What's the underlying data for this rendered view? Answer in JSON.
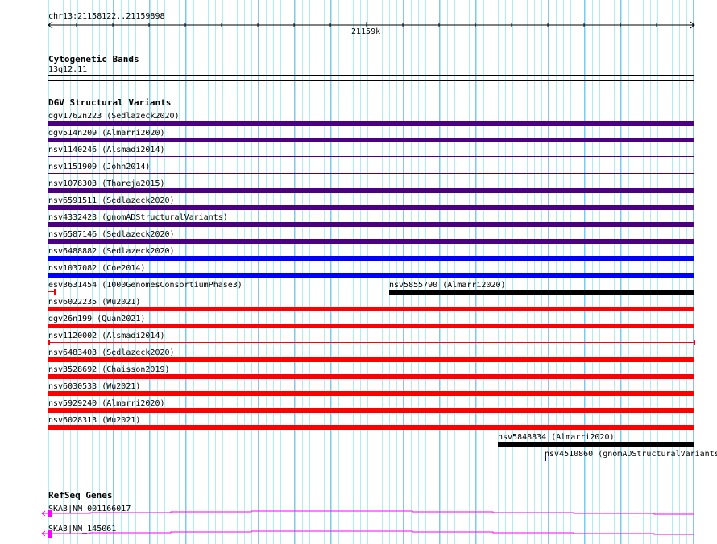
{
  "ruler": {
    "location": "chr13:21158122..21159898",
    "tick_label": "21159k"
  },
  "tracks": {
    "cytobands": {
      "title": "Cytogenetic Bands",
      "band": "13q12.11"
    },
    "dgv": {
      "title": "DGV Structural Variants",
      "features": [
        {
          "label": "dgv1762n223 (Sedlazeck2020)",
          "color": "#4B0082",
          "style": "thick"
        },
        {
          "label": "dgv514n209 (Almarri2020)",
          "color": "#4B0082",
          "style": "thick"
        },
        {
          "label": "nsv1140246 (Alsmadi2014)",
          "color": "#4B0082",
          "style": "thin"
        },
        {
          "label": "nsv1151909 (John2014)",
          "color": "#4B0082",
          "style": "thin"
        },
        {
          "label": "nsv1078303 (Thareja2015)",
          "color": "#4B0082",
          "style": "thick"
        },
        {
          "label": "nsv6591511 (Sedlazeck2020)",
          "color": "#4B0082",
          "style": "thick"
        },
        {
          "label": "nsv4332423 (gnomADStructuralVariants)",
          "color": "#4B0082",
          "style": "thick"
        },
        {
          "label": "nsv6587146 (Sedlazeck2020)",
          "color": "#4B0082",
          "style": "thick"
        },
        {
          "label": "nsv6488882 (Sedlazeck2020)",
          "color": "#0000FF",
          "style": "thick"
        },
        {
          "label": "nsv1037082 (Coe2014)",
          "color": "#0000FF",
          "style": "thick"
        },
        {
          "label": "esv3631454 (1000GenomesConsortiumPhase3)",
          "color": "#FF0000",
          "style": "short"
        },
        {
          "label": "nsv5855790 (Almarri2020)",
          "color": "#000000",
          "style": "thick"
        },
        {
          "label": "nsv6022235 (Wu2021)",
          "color": "#FF0000",
          "style": "thick"
        },
        {
          "label": "dgv26n199 (Quan2021)",
          "color": "#FF0000",
          "style": "thick"
        },
        {
          "label": "nsv1120002 (Alsmadi2014)",
          "color": "#FF0000",
          "style": "thin-ends"
        },
        {
          "label": "nsv6483403 (Sedlazeck2020)",
          "color": "#FF0000",
          "style": "thick"
        },
        {
          "label": "nsv3528692 (Chaisson2019)",
          "color": "#FF0000",
          "style": "thick"
        },
        {
          "label": "nsv6030533 (Wu2021)",
          "color": "#FF0000",
          "style": "thick"
        },
        {
          "label": "nsv5929240 (Almarri2020)",
          "color": "#FF0000",
          "style": "thick"
        },
        {
          "label": "nsv6028313 (Wu2021)",
          "color": "#FF0000",
          "style": "thick"
        },
        {
          "label": "nsv5848834 (Almarri2020)",
          "color": "#000000",
          "style": "thick"
        },
        {
          "label": "nsv4510860 (gnomADStructuralVariants",
          "color": "#0000FF",
          "style": "tiny"
        }
      ]
    },
    "refseq": {
      "title": "RefSeq Genes",
      "genes": [
        {
          "label": "SKA3|NM_001166017",
          "color": "#FF00FF",
          "strand": "-"
        },
        {
          "label": "SKA3|NM_145061",
          "color": "#FF00FF",
          "strand": "-"
        }
      ]
    }
  }
}
